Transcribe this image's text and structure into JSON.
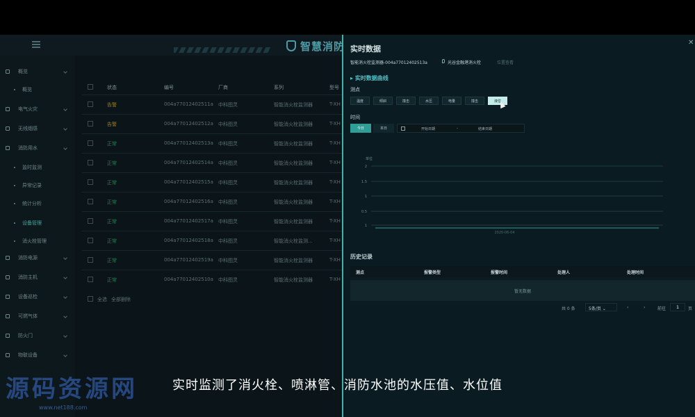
{
  "header": {
    "title": "智慧消防"
  },
  "sidebar": {
    "items": [
      {
        "label": "概览",
        "type": "group"
      },
      {
        "label": "概览",
        "type": "sub"
      },
      {
        "label": "电气火灾",
        "type": "group"
      },
      {
        "label": "无线烟感",
        "type": "group"
      },
      {
        "label": "消防用水",
        "type": "group"
      },
      {
        "label": "监时监测",
        "type": "sub"
      },
      {
        "label": "异常记录",
        "type": "sub"
      },
      {
        "label": "统计分析",
        "type": "sub"
      },
      {
        "label": "设备管理",
        "type": "sub",
        "active": true
      },
      {
        "label": "消火栓管理",
        "type": "sub"
      },
      {
        "label": "消防电源",
        "type": "group"
      },
      {
        "label": "消防主机",
        "type": "group"
      },
      {
        "label": "设备巡检",
        "type": "group"
      },
      {
        "label": "可燃气体",
        "type": "group"
      },
      {
        "label": "防火门",
        "type": "group"
      },
      {
        "label": "物联设备",
        "type": "group"
      }
    ]
  },
  "table": {
    "headers": [
      "状态",
      "编号",
      "厂商",
      "系列",
      "型号"
    ],
    "rows": [
      {
        "status": "告警",
        "status_type": "warn",
        "id": "004a77012402511a",
        "vendor": "中科图灵",
        "series": "智能消火栓监测器",
        "model": "T-XH"
      },
      {
        "status": "告警",
        "status_type": "warn",
        "id": "004a77012402512a",
        "vendor": "中科图灵",
        "series": "智能消火栓监测器",
        "model": "T-XH"
      },
      {
        "status": "正常",
        "status_type": "ok",
        "id": "004a77012402513a",
        "vendor": "中科图灵",
        "series": "智能消火栓监测器",
        "model": "T-XH"
      },
      {
        "status": "正常",
        "status_type": "ok",
        "id": "004a77012402514a",
        "vendor": "中科图灵",
        "series": "智能消火栓监测器",
        "model": "T-XH"
      },
      {
        "status": "正常",
        "status_type": "ok",
        "id": "004a77012402515a",
        "vendor": "中科图灵",
        "series": "智能消火栓监测器",
        "model": "T-XH"
      },
      {
        "status": "正常",
        "status_type": "ok",
        "id": "004a77012402516a",
        "vendor": "中科图灵",
        "series": "智能消火栓监测器",
        "model": "T-XH"
      },
      {
        "status": "正常",
        "status_type": "ok",
        "id": "004a77012402517a",
        "vendor": "中科图灵",
        "series": "智能消火栓监测器",
        "model": "T-XH"
      },
      {
        "status": "正常",
        "status_type": "ok",
        "id": "004a77012402518a",
        "vendor": "中科图灵",
        "series": "智能消火栓监测...",
        "model": "T-XH"
      },
      {
        "status": "正常",
        "status_type": "ok",
        "id": "004a77012402519a",
        "vendor": "中科图灵",
        "series": "智能消火栓监测器",
        "model": "T-XH"
      },
      {
        "status": "正常",
        "status_type": "ok",
        "id": "004a77012402510a",
        "vendor": "中科图灵",
        "series": "智能消火栓监测器",
        "model": "T-XH"
      }
    ],
    "footer": {
      "select_all": "全选",
      "delete_all": "全部删除"
    }
  },
  "panel": {
    "title": "实时数据",
    "device": "智能消火栓监测器-004a77012402513a",
    "location": "光谷金融港消火栓",
    "location_link": "位置查看",
    "curve_title": "实时数据曲线",
    "measure_label": "测点",
    "measure_points": [
      "温度",
      "倾斜",
      "撞击",
      "水压",
      "电量",
      "撞击",
      "液位"
    ],
    "active_point_index": 6,
    "time_label": "时间",
    "time_buttons": [
      "今日",
      "本日"
    ],
    "date_start_placeholder": "开始日期",
    "date_sep": "-",
    "date_end_placeholder": "结束日期",
    "history_title": "历史记录",
    "history_headers": [
      "测点",
      "报警类型",
      "报警时间",
      "处理人",
      "处理时间"
    ],
    "history_empty": "暂无数据",
    "pagination": {
      "total": "共 0 条",
      "page_size": "5条/页",
      "goto": "前往",
      "page": "1",
      "page_unit": "页"
    }
  },
  "chart_data": {
    "type": "line",
    "ylabel": "单位",
    "y_ticks": [
      2,
      1.5,
      1,
      0.5,
      1
    ],
    "x_ticks": [
      "2020-06-04"
    ],
    "series": [
      {
        "x": [
          "2020-06-04"
        ],
        "values": [
          1
        ]
      }
    ]
  },
  "caption": {
    "subtitle": "实时监测了消火栓、喷淋管、消防水池的水压值、水位值"
  },
  "watermark": {
    "logo": "源码资源网",
    "url": "www.net188.com"
  },
  "colors": {
    "accent": "#3fb4ad",
    "warn": "#9a7a1e",
    "ok": "#2d7d55",
    "panel_bg": "#0a1c22"
  }
}
